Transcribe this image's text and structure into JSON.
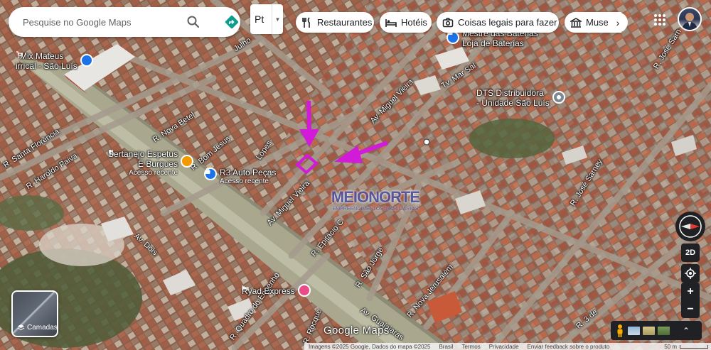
{
  "search": {
    "placeholder": "Pesquise no Google Maps"
  },
  "layer_select": {
    "value": "Pt"
  },
  "chips": [
    {
      "label": "Restaurantes",
      "icon": "fork-knife-icon"
    },
    {
      "label": "Hotéis",
      "icon": "bed-icon"
    },
    {
      "label": "Coisas legais para fazer",
      "icon": "camera-icon"
    },
    {
      "label": "Museu",
      "icon": "museum-icon"
    }
  ],
  "pois": {
    "mix_mateus": {
      "name": "Mix Mateus",
      "line2": "irrical - São Luís"
    },
    "mestre_baterias": {
      "name": "Mestre das Baterias",
      "line2": "Loja de Baterias"
    },
    "dts": {
      "name": "DTS Distribuidora",
      "line2": "- Unidade São Luís"
    },
    "sertanejo": {
      "name": "Sertanejo Espetus",
      "line2": "E Burgues",
      "sub": "Acesso recente"
    },
    "r3": {
      "name": "R3 Auto Peças",
      "sub": "Acesso recente"
    },
    "ryad": {
      "name": "Ryad Express"
    }
  },
  "streets": {
    "julho": "Julho",
    "santa_florencia": "R. Santa Florência",
    "haroldo_paiva": "R. Haroldo Paiva",
    "nova_betel": "R. Nova Betel",
    "bom_jesus": "R. Bom Jesus",
    "lopes": "Lopes",
    "miguel_vieira_top": "Av. Miguel Vieira",
    "miguel_vieira_bottom": "Av. Miguel Vieira",
    "tv_mar": "Tv. Mar Sal",
    "jose_sarney_top": "R. José Sarn",
    "jose_sarney_mid": "R. José Sarney",
    "epitacio": "R. Epitácio C",
    "sao_jorge": "R. São Jorge",
    "nova_jerusalem": "R. Nova Jerusalém",
    "av_dois": "Av. Dois",
    "quadro_engenho": "R. Quadro do Engenho",
    "r_rocque": "R. Rocque",
    "guajajaras": "Av. Guajajaras",
    "r3_right": "R. 3 de"
  },
  "watermark": {
    "title": "MEIONORTE",
    "subtitle": "EMPREENDIMENTOS IMOBILIÁRIOS"
  },
  "controls": {
    "mode_2d": "2D",
    "zoom_in": "+",
    "zoom_out": "−",
    "layers": "Camadas",
    "next": "›"
  },
  "logo": "Google Maps",
  "footer": {
    "attribution": "Imagens ©2025 Google, Dados do mapa ©2025",
    "country": "Brasil",
    "terms": "Termos",
    "privacy": "Privacidade",
    "feedback": "Enviar feedback sobre o produto",
    "scale": "50 m"
  },
  "colors": {
    "accent_blue": "#1a73e8",
    "poi_orange": "#f29900",
    "poi_pink": "#ea4c89",
    "poi_gray": "#7b8a94",
    "annotation_magenta": "#d21ad9",
    "directions_teal": "#0f9d8f"
  }
}
